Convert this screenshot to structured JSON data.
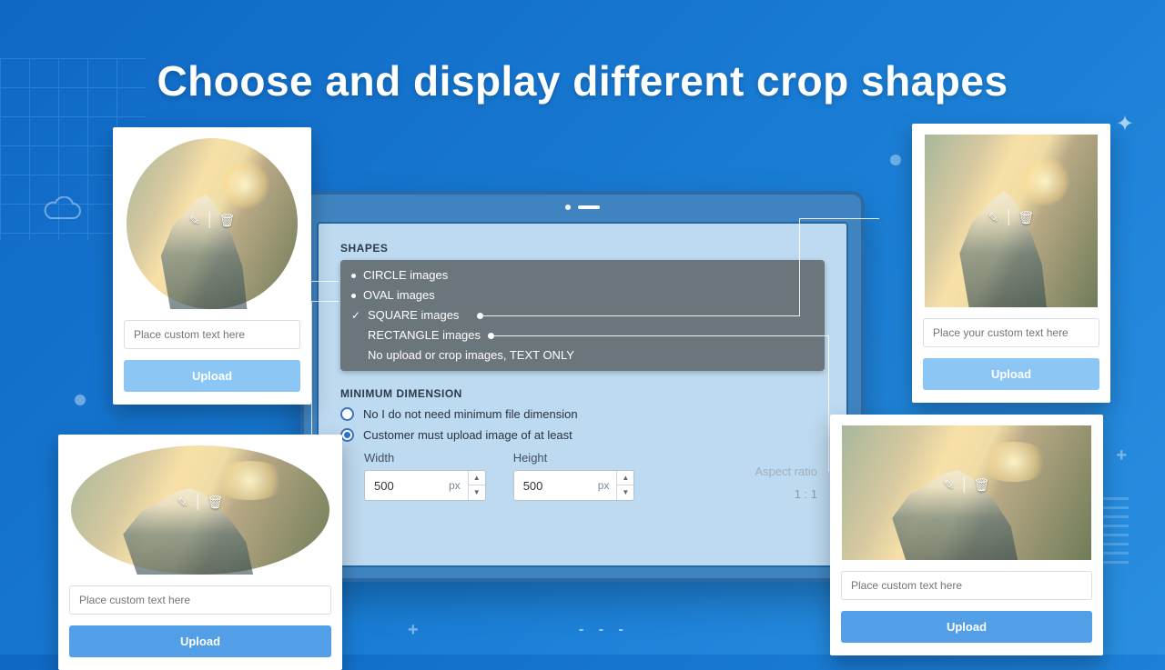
{
  "title": "Choose and display different crop shapes",
  "panel": {
    "shapes_label": "SHAPES",
    "options": [
      {
        "label": "CIRCLE images",
        "marker": "bullet"
      },
      {
        "label": "OVAL images",
        "marker": "bullet"
      },
      {
        "label": "SQUARE images",
        "marker": "check"
      },
      {
        "label": "RECTANGLE images",
        "marker": "none"
      },
      {
        "label": "No upload or crop images, TEXT ONLY",
        "marker": "none"
      }
    ],
    "min_label": "MINIMUM DIMENSION",
    "radio_no": "No I do not need minimum file dimension",
    "radio_yes": "Customer must upload image of at least",
    "width_label": "Width",
    "height_label": "Height",
    "width_value": "500",
    "height_value": "500",
    "unit": "px",
    "aspect_label": "Aspect ratio",
    "aspect_value": "1 : 1"
  },
  "cards": {
    "circle": {
      "placeholder": "Place custom text here",
      "button": "Upload"
    },
    "oval": {
      "placeholder": "Place custom text here",
      "button": "Upload"
    },
    "square": {
      "placeholder": "Place your custom text here",
      "button": "Upload"
    },
    "rect": {
      "placeholder": "Place custom text here",
      "button": "Upload"
    }
  },
  "icons": {
    "edit": "✎",
    "trash": "🗑"
  }
}
